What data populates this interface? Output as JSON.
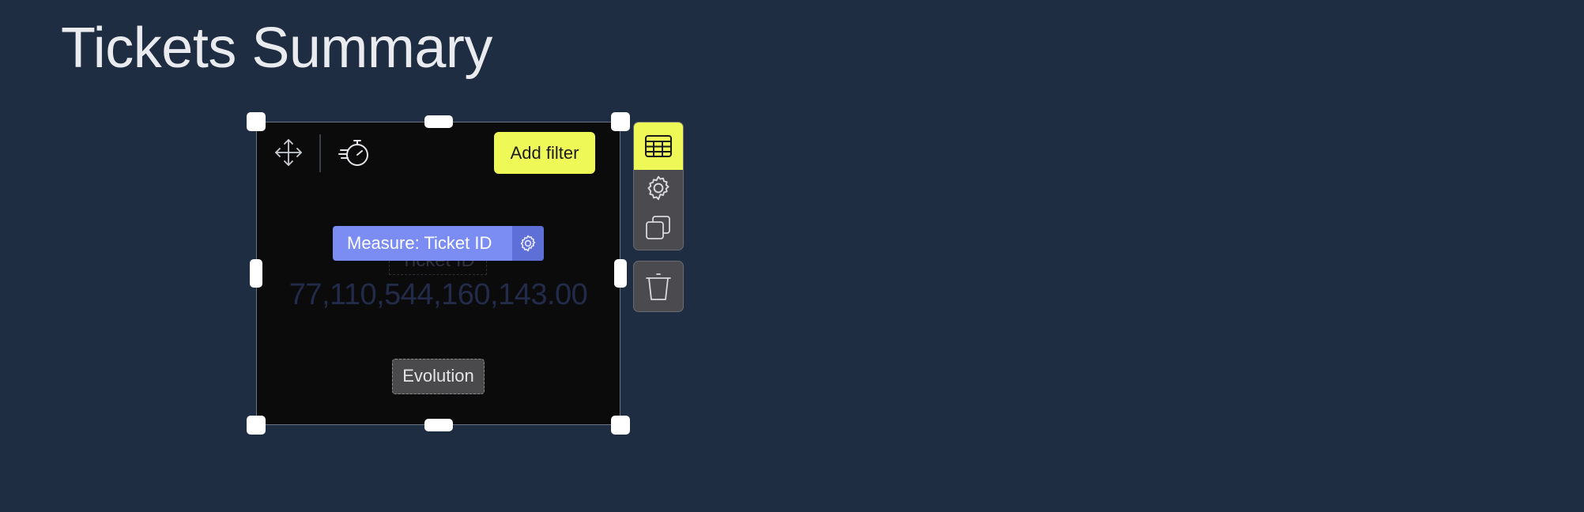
{
  "page": {
    "title": "Tickets Summary"
  },
  "widget": {
    "toolbar": {
      "move_icon": "move-arrows-icon",
      "timer_icon": "stopwatch-icon",
      "add_filter_label": "Add filter"
    },
    "measure": {
      "label": "Measure: Ticket ID",
      "settings_icon": "gear-icon"
    },
    "kpi": {
      "field_label": "Ticket ID",
      "value": "77,110,544,160,143.00"
    },
    "evolution_label": "Evolution"
  },
  "side_actions": [
    {
      "icon": "table-icon",
      "active": true
    },
    {
      "icon": "gear-icon",
      "active": false
    },
    {
      "icon": "duplicate-icon",
      "active": false
    }
  ],
  "delete_action": {
    "icon": "trash-icon"
  },
  "colors": {
    "background": "#1f2d42",
    "widget_bg": "#0b0b0b",
    "accent_yellow": "#eef857",
    "measure_blue": "#7b8cf2",
    "panel_gray": "#4a4a4f"
  }
}
